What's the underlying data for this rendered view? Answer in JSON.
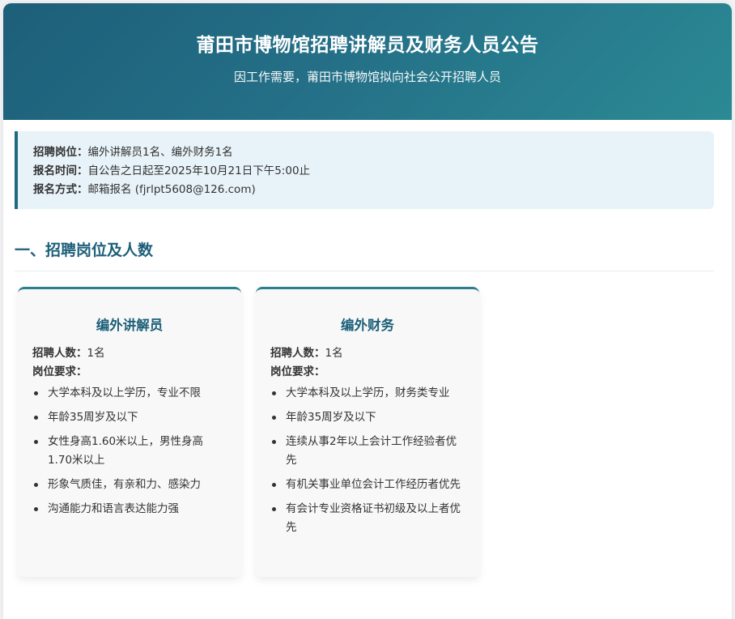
{
  "header": {
    "title": "莆田市博物馆招聘讲解员及财务人员公告",
    "subtitle": "因工作需要，莆田市博物馆拟向社会公开招聘人员"
  },
  "info": {
    "positions_label": "招聘岗位：",
    "positions_value": "编外讲解员1名、编外财务1名",
    "deadline_label": "报名时间：",
    "deadline_value": "自公告之日起至2025年10月21日下午5:00止",
    "method_label": "报名方式：",
    "method_value": "邮箱报名 (fjrlpt5608@126.com)"
  },
  "section": {
    "title": "一、招聘岗位及人数"
  },
  "cards": [
    {
      "title": "编外讲解员",
      "count_label": "招聘人数：",
      "count_value": "1名",
      "req_label": "岗位要求：",
      "requirements": [
        "大学本科及以上学历，专业不限",
        "年龄35周岁及以下",
        "女性身高1.60米以上，男性身高1.70米以上",
        "形象气质佳，有亲和力、感染力",
        "沟通能力和语言表达能力强"
      ]
    },
    {
      "title": "编外财务",
      "count_label": "招聘人数：",
      "count_value": "1名",
      "req_label": "岗位要求：",
      "requirements": [
        "大学本科及以上学历，财务类专业",
        "年龄35周岁及以下",
        "连续从事2年以上会计工作经验者优先",
        "有机关事业单位会计工作经历者优先",
        "有会计专业资格证书初级及以上者优先"
      ]
    }
  ],
  "colors": {
    "header_start": "#1d5f79",
    "header_end": "#2b8a94",
    "accent": "#1d5f79",
    "info_bg": "#e8f3f9"
  }
}
